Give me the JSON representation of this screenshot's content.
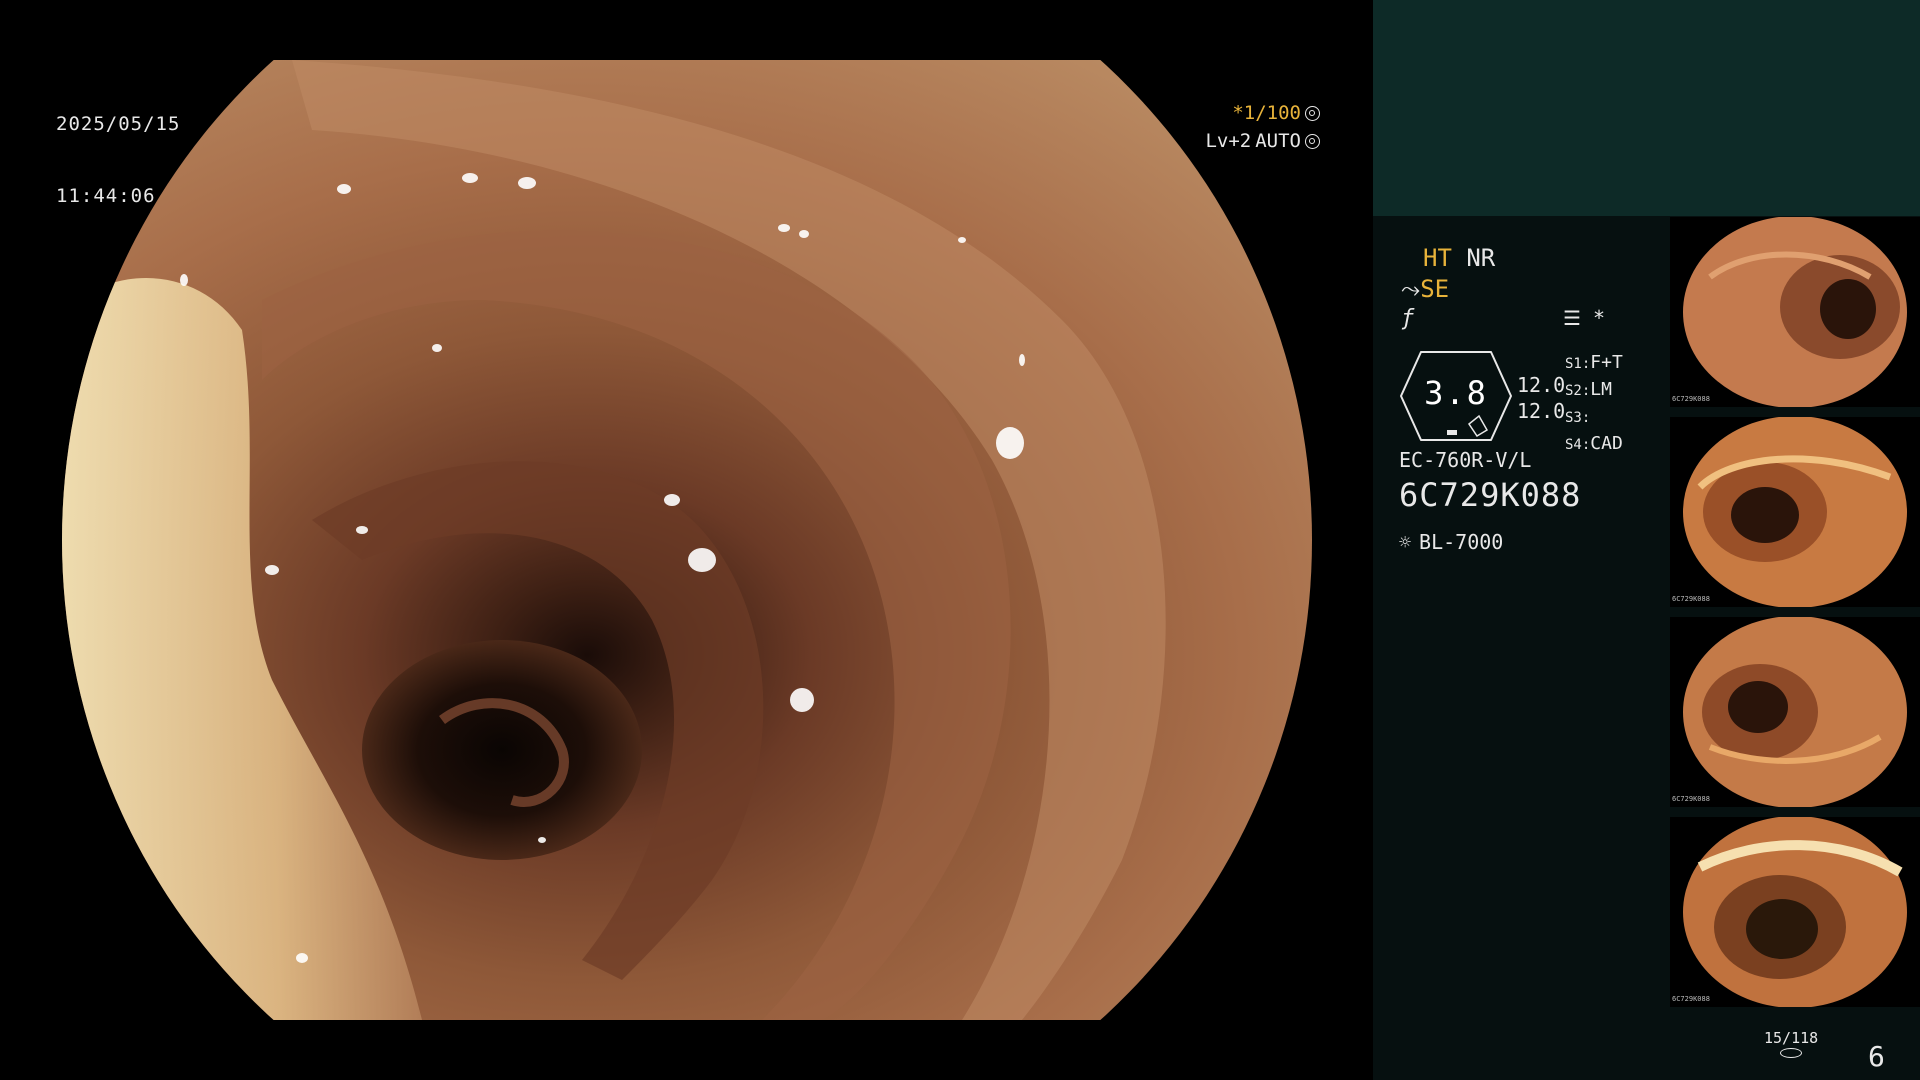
{
  "overlay": {
    "date": "2025/05/15",
    "time": "11:44:06",
    "shutter_speed": "*1/100",
    "level": "Lv+2",
    "mode": "AUTO"
  },
  "panel": {
    "ht": "HT",
    "nr": "NR",
    "se": "SE",
    "gauge_value": "3.8",
    "gauge_num_1": "12.0",
    "gauge_num_2": "12.0",
    "settings": [
      {
        "key": "S1:",
        "value": "F+T"
      },
      {
        "key": "S2:",
        "value": "LM"
      },
      {
        "key": "S3:",
        "value": ""
      },
      {
        "key": "S4:",
        "value": "CAD"
      }
    ],
    "scope_model": "EC-760R-V/L",
    "scope_serial": "6C729K088",
    "light_source": "BL-7000",
    "asterisk": "*"
  },
  "thumbnails": [
    {
      "caption": "6C729K088"
    },
    {
      "caption": "6C729K088"
    },
    {
      "caption": "6C729K088"
    },
    {
      "caption": "6C729K088"
    }
  ],
  "footer": {
    "counter": "15/118",
    "page": "6"
  },
  "colors": {
    "accent_yellow": "#e8b33a",
    "panel_top": "#0d2a27",
    "panel_bg": "#061010"
  }
}
